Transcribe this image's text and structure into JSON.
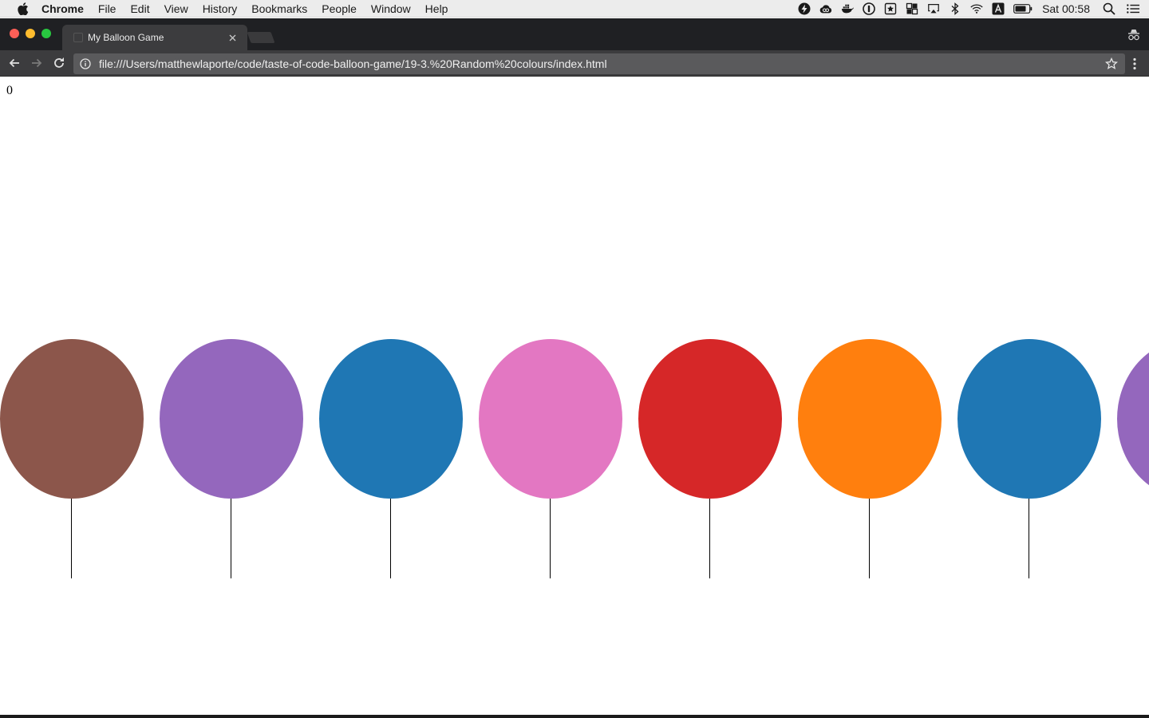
{
  "menubar": {
    "app_name": "Chrome",
    "items": [
      "File",
      "Edit",
      "View",
      "History",
      "Bookmarks",
      "People",
      "Window",
      "Help"
    ],
    "clock": "Sat 00:58",
    "status_icons": [
      "bolt-icon",
      "creative-cloud-icon",
      "docker-icon",
      "1password-icon",
      "reeder-icon",
      "grid-app-icon",
      "airplay-icon",
      "bluetooth-icon",
      "wifi-icon",
      "input-source-icon",
      "battery-icon",
      "spotlight-icon",
      "notification-center-icon"
    ]
  },
  "browser": {
    "tab_title": "My Balloon Game",
    "url": "file:///Users/matthewlaporte/code/taste-of-code-balloon-game/19-3.%20Random%20colours/index.html"
  },
  "page": {
    "score": "0",
    "balloons": [
      {
        "color": "#8c564b"
      },
      {
        "color": "#9467bd"
      },
      {
        "color": "#1f77b4"
      },
      {
        "color": "#e377c2"
      },
      {
        "color": "#d62728"
      },
      {
        "color": "#ff7f0e"
      },
      {
        "color": "#1f77b4"
      },
      {
        "color": "#9467bd"
      }
    ]
  }
}
